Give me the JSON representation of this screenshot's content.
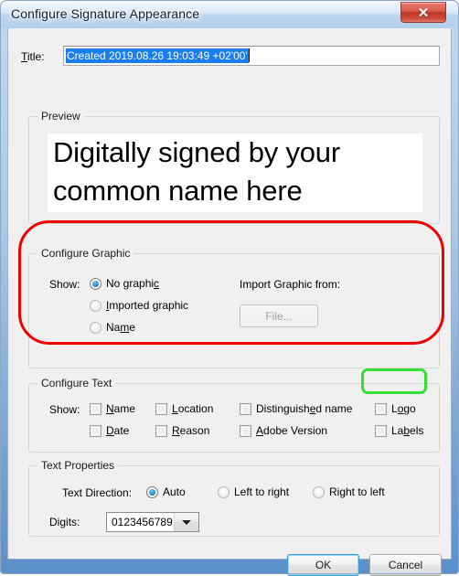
{
  "window": {
    "title": "Configure Signature Appearance",
    "close_icon": "close-x-icon"
  },
  "title_field": {
    "label": "Title:",
    "label_accel": "T",
    "value": "Created 2019.08.26 19:03:49 +02'00'",
    "selected": true
  },
  "preview": {
    "legend": "Preview",
    "text_line_1": "Digitally signed by your",
    "text_line_2": "common name here"
  },
  "configure_graphic": {
    "legend": "Configure Graphic",
    "show_label": "Show:",
    "import_label": "Import Graphic from:",
    "file_button": "File...",
    "file_button_enabled": false,
    "options": [
      {
        "label": "No graphic",
        "accel": "c",
        "selected": true
      },
      {
        "label": "Imported graphic",
        "accel": "I",
        "selected": false
      },
      {
        "label": "Name",
        "accel": "m",
        "selected": false
      }
    ]
  },
  "configure_text": {
    "legend": "Configure Text",
    "show_label": "Show:",
    "checkboxes": [
      {
        "label": "Name",
        "accel": "N",
        "checked": false,
        "col": 0,
        "row": 0
      },
      {
        "label": "Location",
        "accel": "L",
        "checked": false,
        "col": 1,
        "row": 0
      },
      {
        "label": "Distinguished name",
        "accel": "e",
        "checked": false,
        "col": 2,
        "row": 0
      },
      {
        "label": "Logo",
        "accel": "o",
        "checked": false,
        "col": 3,
        "row": 0
      },
      {
        "label": "Date",
        "accel": "D",
        "checked": false,
        "col": 0,
        "row": 1
      },
      {
        "label": "Reason",
        "accel": "R",
        "checked": false,
        "col": 1,
        "row": 1
      },
      {
        "label": "Adobe Version",
        "accel": "A",
        "checked": false,
        "col": 2,
        "row": 1
      },
      {
        "label": "Labels",
        "accel": "b",
        "checked": false,
        "col": 3,
        "row": 1
      }
    ]
  },
  "text_properties": {
    "legend": "Text Properties",
    "direction_label": "Text Direction:",
    "direction_options": [
      {
        "label": "Auto",
        "selected": true
      },
      {
        "label": "Left to right",
        "selected": false
      },
      {
        "label": "Right to left",
        "selected": false
      }
    ],
    "digits_label": "Digits:",
    "digits_label_accel": "g",
    "digits_value": "0123456789"
  },
  "footer": {
    "ok": "OK",
    "cancel": "Cancel"
  },
  "annotations": {
    "red_highlight_color": "#ef0000",
    "green_highlight_color": "#35e035",
    "red_target": "configure-graphic-group",
    "green_target": "logo-checkbox"
  }
}
